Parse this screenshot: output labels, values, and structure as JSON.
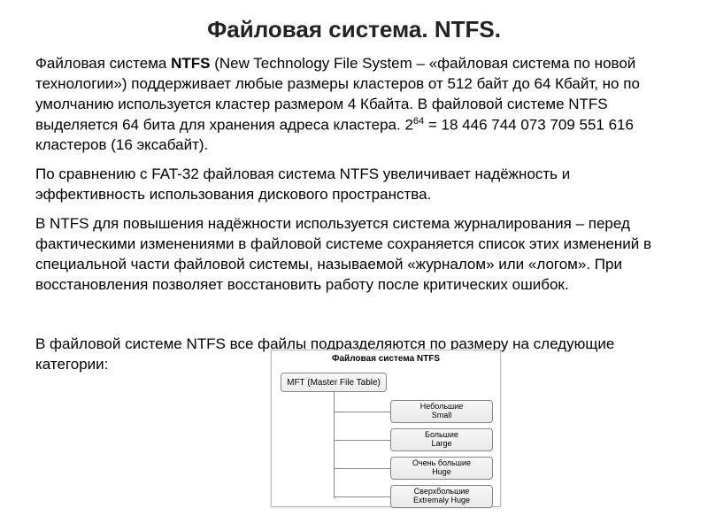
{
  "title": "Файловая система. NTFS.",
  "p1a": "Файловая система ",
  "p1bold": "NTFS",
  "p1b": " (New Technology File System – «файловая система по новой технологии») поддерживает любые размеры кластеров от 512 байт до 64 Кбайт, но по умолчанию используется кластер размером 4 Кбайта. В файловой системе NTFS выделяется 64 бита для хранения адреса кластера. 2",
  "p1sup": "64",
  "p1c": " = 18 446 744 073 709 551 616 кластеров (16 эксабайт).",
  "p2": "По сравнению с FAT-32 файловая система NTFS увеличивает надёжность и эффективность использования дискового пространства.",
  "p3": "В NTFS для повышения надёжности используется система журналирования – перед фактическими изменениями в файловой системе сохраняется список этих изменений в специальной части файловой системы, называемой «журналом» или «логом». При восстановления позволяет восстановить работу после критических ошибок.",
  "overlap": "В файловой системе NTFS все файлы подразделяются по размеру на следующие категории:",
  "diagram": {
    "title": "Файловая система NTFS",
    "mft": "MFT (Master File Table)",
    "cats": [
      {
        "ru": "Небольшие",
        "en": "Small"
      },
      {
        "ru": "Большие",
        "en": "Large"
      },
      {
        "ru": "Очень большие",
        "en": "Huge"
      },
      {
        "ru": "Сверхбольшие",
        "en": "Extremaly Huge"
      }
    ]
  }
}
